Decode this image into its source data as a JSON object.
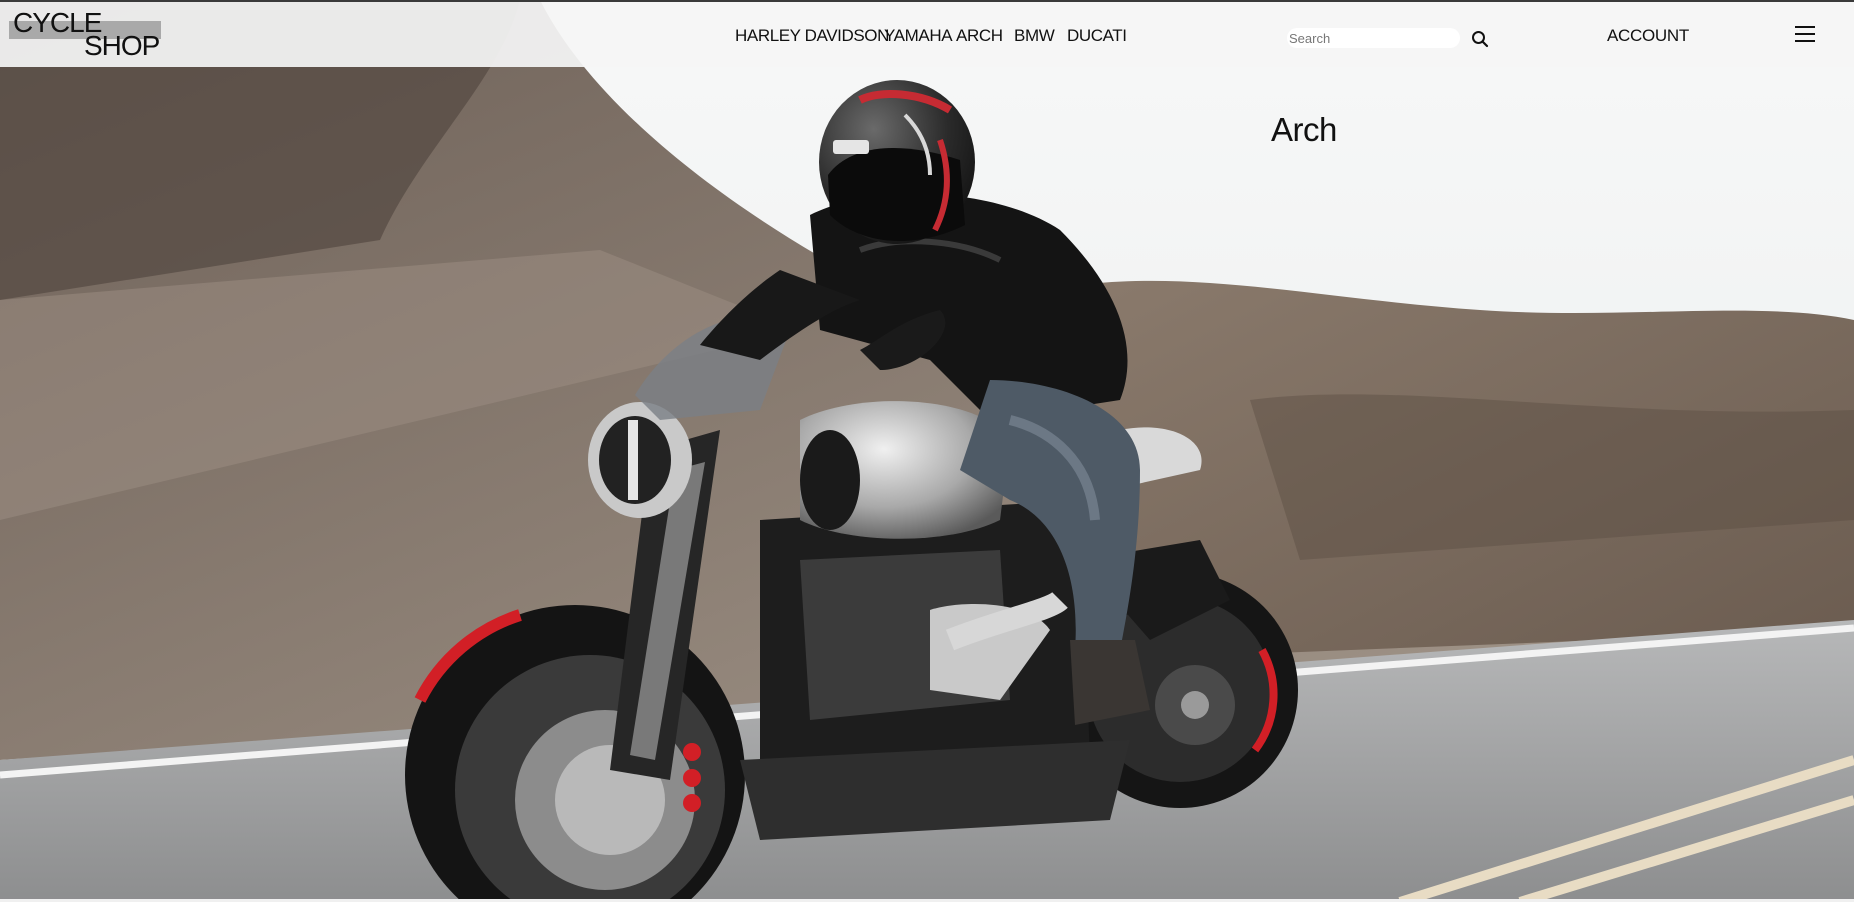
{
  "brand": {
    "line1": "CYCLE",
    "line2": "SHOP"
  },
  "nav": {
    "items": [
      {
        "label": "HARLEY DAVIDSON"
      },
      {
        "label": "YAMAHA"
      },
      {
        "label": "ARCH"
      },
      {
        "label": "BMW"
      },
      {
        "label": "DUCATI"
      }
    ]
  },
  "search": {
    "placeholder": "Search",
    "value": "",
    "icon": "search-icon"
  },
  "account": {
    "label": "ACCOUNT"
  },
  "menu": {
    "icon": "hamburger-menu-icon"
  },
  "hero": {
    "title": "Arch",
    "image": "motorcycle-rider-on-road-photo"
  },
  "colors": {
    "header_bg": "#f5f5f5",
    "text": "#111111",
    "logo_band": "#a9a9a9",
    "accent_red": "#d21f26"
  }
}
